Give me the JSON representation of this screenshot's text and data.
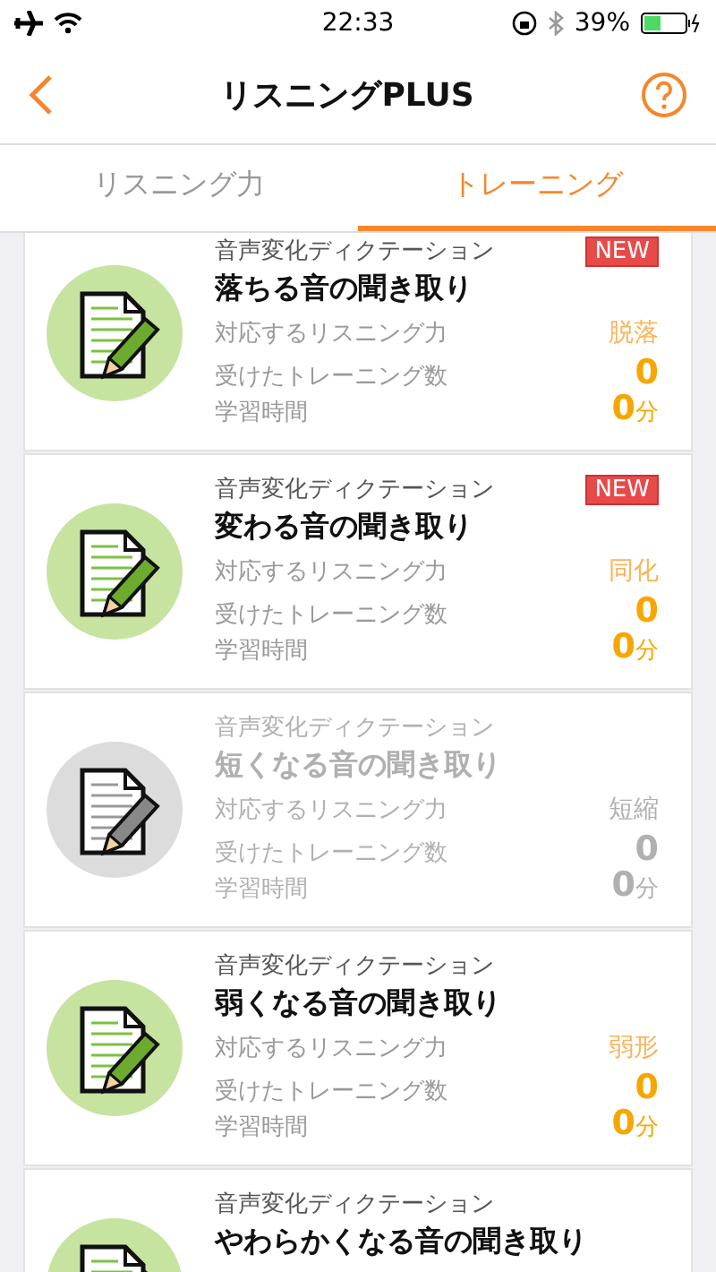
{
  "status_bar": {
    "time": "22:33",
    "battery": "39%"
  },
  "nav": {
    "title": "リスニングPLUS"
  },
  "tabs": [
    {
      "label": "リスニング力",
      "selected": false
    },
    {
      "label": "トレーニング",
      "selected": true
    }
  ],
  "cards": [
    {
      "category": "音声変化ディクテーション",
      "title": "落ちる音の聞き取り",
      "badge": "NEW",
      "disabled": false,
      "rows": [
        {
          "label": "対応するリスニング力",
          "value": "脱落",
          "kind": "skill"
        },
        {
          "label": "受けたトレーニング数",
          "value": "0",
          "kind": "count"
        },
        {
          "label": "学習時間",
          "value": "**0**分",
          "kind": "time"
        }
      ]
    },
    {
      "category": "音声変化ディクテーション",
      "title": "変わる音の聞き取り",
      "badge": "NEW",
      "disabled": false,
      "rows": [
        {
          "label": "対応するリスニング力",
          "value": "同化",
          "kind": "skill"
        },
        {
          "label": "受けたトレーニング数",
          "value": "0",
          "kind": "count"
        },
        {
          "label": "学習時間",
          "value": "**0**分",
          "kind": "time"
        }
      ]
    },
    {
      "category": "音声変化ディクテーション",
      "title": "短くなる音の聞き取り",
      "disabled": true,
      "rows": [
        {
          "label": "対応するリスニング力",
          "value": "短縮",
          "kind": "skill"
        },
        {
          "label": "受けたトレーニング数",
          "value": "0",
          "kind": "count"
        },
        {
          "label": "学習時間",
          "value": "**0**分",
          "kind": "time"
        }
      ]
    },
    {
      "category": "音声変化ディクテーション",
      "title": "弱くなる音の聞き取り",
      "disabled": false,
      "rows": [
        {
          "label": "対応するリスニング力",
          "value": "弱形",
          "kind": "skill"
        },
        {
          "label": "受けたトレーニング数",
          "value": "0",
          "kind": "count"
        },
        {
          "label": "学習時間",
          "value": "**0**分",
          "kind": "time"
        }
      ]
    },
    {
      "category": "音声変化ディクテーション",
      "title": "やわらかくなる音の聞き取り",
      "disabled": false
    }
  ]
}
